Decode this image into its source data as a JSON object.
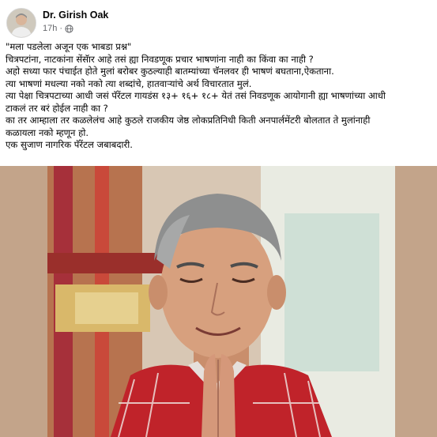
{
  "post": {
    "author": "Dr. Girish Oak",
    "time": "17h",
    "separator": "·",
    "privacy_icon": "globe-icon",
    "lines": [
      "\"मला पडलेला अजून एक भाबडा प्रश्न\"",
      "चित्रपटांना, नाटकांना सेंसॅार आहे तसं ह्या निवडणूक प्रचार भाषणांना नाही का किंवा का नाही ?",
      "अहो सध्या फार पंचाईत होते मुलां बरोबर कुठल्याही बातम्यांच्या चॅनलवर ही भाषणं बघताना,ऐकताना.",
      "त्या भाषणां मधल्या नको नको त्या शब्दांचे, हातवाऱ्यांचे अर्थ विचारतात मुलं.",
      "त्या पेक्षा चित्रपटाच्या आधी जसं पॅरेंटल गायडंस १३+ १६+ १८+ येतं तसं निवडणूक आयोगानी ह्या भाषणांच्या आधी",
      "टाकलं तर बरं होईल नाही का ?",
      "का तर आम्हाला तर कळलेलंच आहे कुठले राजकीय जेष्ठ लोकप्रतिनिधी किती अनपार्लमेंटरी बोलतात ते मुलांनाही",
      "कळायला नको म्हणून हो.",
      "एक सुजाण नागरिक पॅरेंटल जबाबदारी."
    ]
  },
  "colors": {
    "text": "#050505",
    "meta": "#65676b",
    "shirt_red": "#c0232a"
  }
}
